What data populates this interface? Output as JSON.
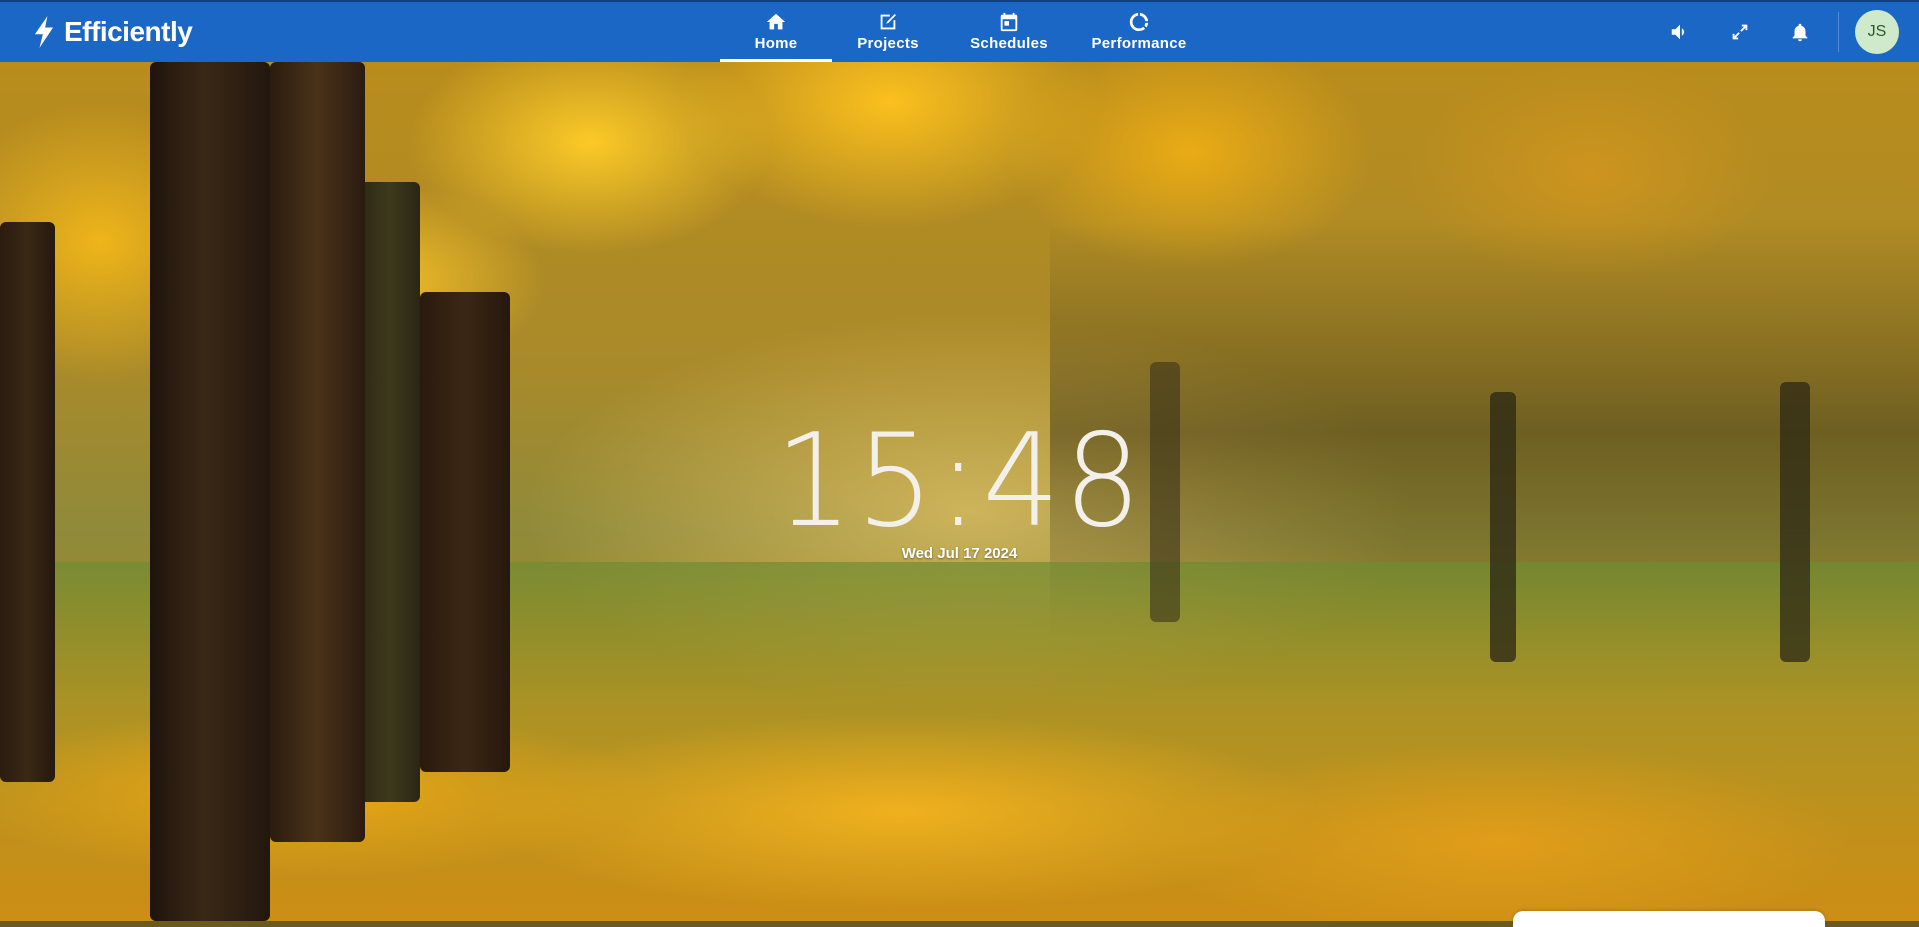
{
  "app": {
    "name": "Efficiently"
  },
  "nav": {
    "items": [
      {
        "label": "Home",
        "icon": "home-icon",
        "active": true
      },
      {
        "label": "Projects",
        "icon": "edit-icon",
        "active": false
      },
      {
        "label": "Schedules",
        "icon": "calendar-icon",
        "active": false
      },
      {
        "label": "Performance",
        "icon": "donut-chart-icon",
        "active": false
      }
    ]
  },
  "header_actions": {
    "sound_icon": "volume-icon",
    "fullscreen_icon": "fullscreen-icon",
    "notifications_icon": "bell-icon",
    "avatar_initials": "JS"
  },
  "clock": {
    "time": "15:48",
    "date": "Wed Jul 17 2024"
  },
  "colors": {
    "header": "#1b67c5",
    "avatar_bg": "#cfeacb"
  }
}
